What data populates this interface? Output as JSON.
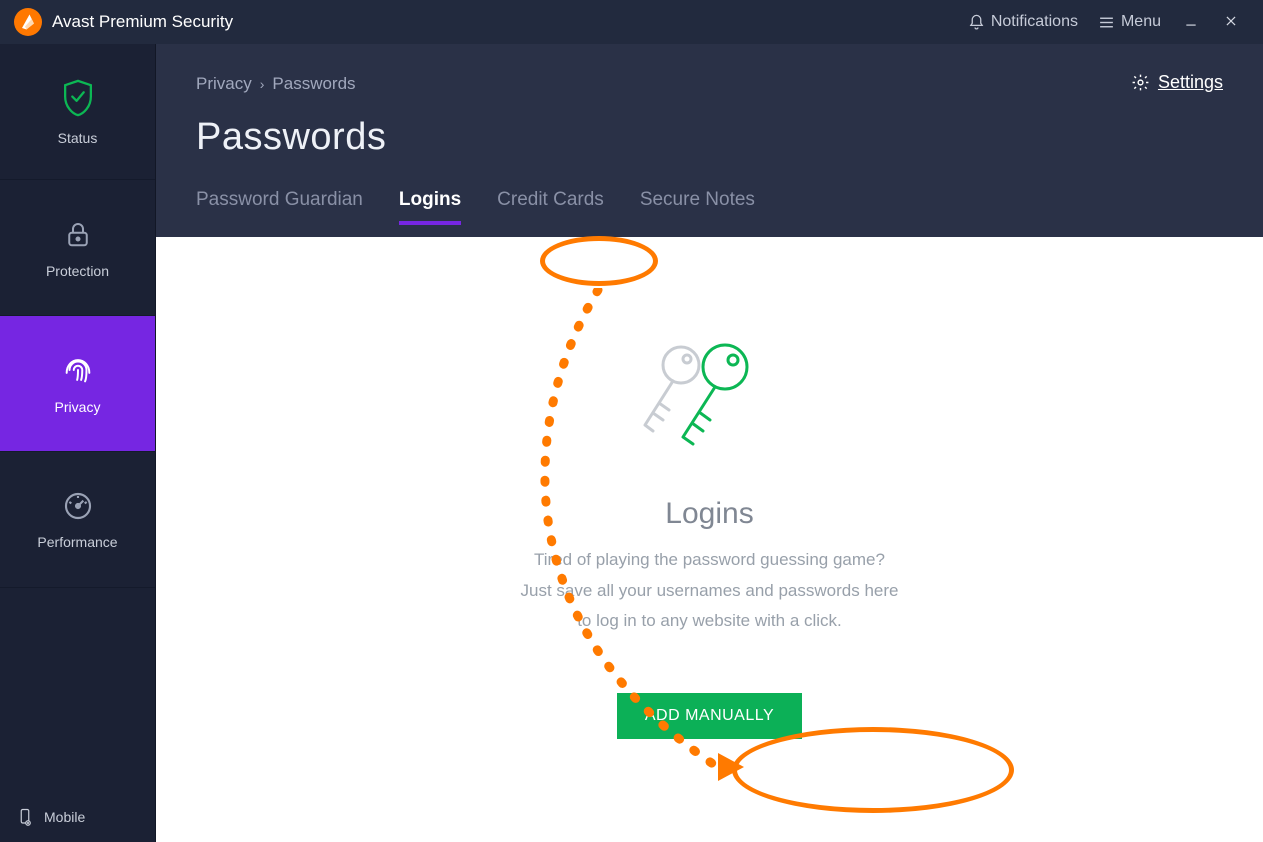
{
  "titlebar": {
    "app_name": "Avast Premium Security",
    "notifications": "Notifications",
    "menu": "Menu"
  },
  "sidebar": {
    "items": [
      {
        "label": "Status"
      },
      {
        "label": "Protection"
      },
      {
        "label": "Privacy"
      },
      {
        "label": "Performance"
      }
    ],
    "footer": {
      "mobile": "Mobile"
    }
  },
  "header": {
    "breadcrumb_root": "Privacy",
    "breadcrumb_current": "Passwords",
    "page_title": "Passwords",
    "settings_label": "Settings"
  },
  "tabs": [
    {
      "label": "Password Guardian"
    },
    {
      "label": "Logins"
    },
    {
      "label": "Credit Cards"
    },
    {
      "label": "Secure Notes"
    }
  ],
  "empty_state": {
    "title": "Logins",
    "line1": "Tired of playing the password guessing game?",
    "line2": "Just save all your usernames and passwords here",
    "line3": "to log in to any website with a click.",
    "button": "ADD MANUALLY"
  }
}
